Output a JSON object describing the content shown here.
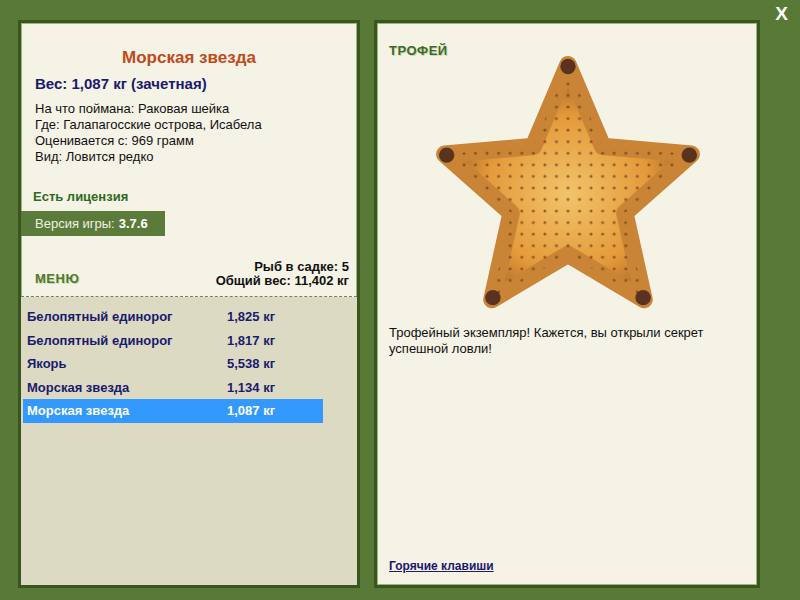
{
  "window": {
    "close": "X"
  },
  "fish": {
    "name": "Морская звезда",
    "weight": "Вес: 1,087 кг (зачетная)",
    "details": [
      "На что поймана: Раковая шейка",
      "Где: Галапагосские острова, Исабела",
      "Оценивается с: 969 грамм",
      "Вид: Ловится редко"
    ],
    "license": "Есть лицензия",
    "version_label": "Версия игры:",
    "version": "3.7.6"
  },
  "menu": {
    "title": "МЕНЮ",
    "count": "Рыб в садке: 5",
    "total": "Общий вес: 11,402 кг"
  },
  "catch": [
    {
      "name": "Белопятный единорог",
      "weight": "1,825 кг",
      "selected": false
    },
    {
      "name": "Белопятный единорог",
      "weight": "1,817 кг",
      "selected": false
    },
    {
      "name": "Якорь",
      "weight": "5,538 кг",
      "selected": false
    },
    {
      "name": "Морская звезда",
      "weight": "1,134 кг",
      "selected": false
    },
    {
      "name": "Морская звезда",
      "weight": "1,087 кг",
      "selected": true
    }
  ],
  "trophy": {
    "title": "ТРОФЕЙ",
    "message": "Трофейный экземпляр! Кажется, вы открыли секрет успешной ловли!",
    "hotkeys": "Горячие клавиши"
  }
}
